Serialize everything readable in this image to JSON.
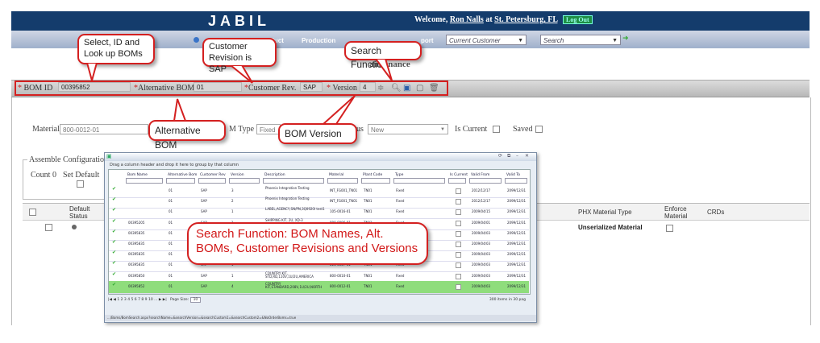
{
  "header": {
    "logo": "JABIL",
    "welcome_prefix": "Welcome,",
    "user": "Ron Nalls",
    "at": "at",
    "location": "St. Petersburg, FL",
    "logout": "Log Out"
  },
  "nav": {
    "items": [
      "duct",
      "Production",
      "port"
    ],
    "customer_select": "Current Customer",
    "search_select": "Search"
  },
  "page_title": "aintenance",
  "bom_bar": {
    "bom_id_label": "BOM ID",
    "bom_id_value": "00395852",
    "alt_bom_label": "Alternative BOM",
    "alt_bom_value": "01",
    "cust_rev_label": "Customer Rev.",
    "cust_rev_value": "SAP",
    "version_label": "Version",
    "version_value": "4"
  },
  "form": {
    "material_label": "Material",
    "material_value": "800-0012-01",
    "bom_type_label": "M Type",
    "bom_type_value": "Fixed",
    "status_label": "us",
    "status_value": "New",
    "is_current_label": "Is Current",
    "saved_label": "Saved",
    "assemble_config_label": "Assemble Configuratio",
    "count_label": "Count 0",
    "set_default_label": "Set Default"
  },
  "grid_header": {
    "default_status": "Default Status",
    "phx_material_type": "PHX Material Type",
    "enforce_material": "Enforce Material",
    "crds": "CRDs"
  },
  "grid_row": {
    "phx_value": "Unserialized Material"
  },
  "popup": {
    "group_hint": "Drag a column header and drop it here to group by that column",
    "columns": [
      "Bom Name",
      "Alternative Bom",
      "Customer Rev",
      "Version",
      "Description",
      "Material",
      "Plant Code",
      "Type",
      "Is Current",
      "Valid From",
      "Valid To"
    ],
    "rows": [
      {
        "bom": "",
        "alt": "01",
        "rev": "SAP",
        "ver": "3",
        "desc": "Phoenix Integration Testing",
        "mat": "INT_FG001_TN01",
        "plant": "TN01",
        "type": "Fixed",
        "from": "2012/12/17",
        "to": "2099/12/31"
      },
      {
        "bom": "",
        "alt": "01",
        "rev": "SAP",
        "ver": "2",
        "desc": "Phoenix Integration Testing",
        "mat": "INT_FG001_TN01",
        "plant": "TN01",
        "type": "Fixed",
        "from": "2012/12/17",
        "to": "2099/12/31"
      },
      {
        "bom": "",
        "alt": "01",
        "rev": "SAP",
        "ver": "1",
        "desc": "LABEL,AGENCY,SN/PN,3Q0920I test1",
        "mat": "105-0016-01",
        "plant": "TN01",
        "type": "Fixed",
        "from": "2009/04/15",
        "to": "2099/12/31"
      },
      {
        "bom": "00395205",
        "alt": "01",
        "rev": "SAP",
        "ver": "1",
        "desc": "SHIPPING KIT, 2U, XD-3",
        "mat": "800-0006-01",
        "plant": "TN01",
        "type": "Fixed",
        "from": "2009/04/01",
        "to": "2099/12/31"
      },
      {
        "bom": "00395835",
        "alt": "01",
        "rev": "",
        "ver": "",
        "desc": "",
        "mat": "",
        "plant": "",
        "type": "",
        "from": "2009/04/03",
        "to": "2099/12/31"
      },
      {
        "bom": "00395835",
        "alt": "01",
        "rev": "",
        "ver": "",
        "desc": "",
        "mat": "",
        "plant": "",
        "type": "",
        "from": "2009/04/03",
        "to": "2099/12/31"
      },
      {
        "bom": "00395835",
        "alt": "01",
        "rev": "",
        "ver": "",
        "desc": "",
        "mat": "",
        "plant": "",
        "type": "",
        "from": "2009/04/03",
        "to": "2099/12/31"
      },
      {
        "bom": "00395835",
        "alt": "01",
        "rev": "SAP",
        "ver": "1",
        "desc": "SPARES KIT, 250GB HD, SATA ROHS",
        "mat": "811-0057-01",
        "plant": "TN01",
        "type": "Fixed",
        "from": "2009/04/03",
        "to": "2099/12/31"
      },
      {
        "bom": "00395850",
        "alt": "01",
        "rev": "SAP",
        "ver": "1",
        "desc": "COUNTRY KIT, STD,RD,110V,1U/2U,AMERICA",
        "mat": "800-0010-01",
        "plant": "TN01",
        "type": "Fixed",
        "from": "2009/04/03",
        "to": "2099/12/31"
      },
      {
        "bom": "00395852",
        "alt": "01",
        "rev": "SAP",
        "ver": "4",
        "desc": "COUNTRY KIT,STANDARD,208V,1U/2U,NORTH",
        "mat": "800-0012-01",
        "plant": "TN01",
        "type": "Fixed",
        "from": "2009/04/03",
        "to": "2099/12/31"
      }
    ],
    "pager": "1 2 3 4 5 6 7 8 9 10 ...",
    "page_size_label": "Page Size:",
    "page_size_value": "10",
    "items_info": "300 items in 30 pag",
    "status_url": ".../Boms/BomSearch.aspx?searchName=&searchVersion=&searchCustom1=&searchCustom2=&NoOrderBoms=true"
  },
  "callouts": {
    "select_id": "Select, ID and Look up BOMs",
    "customer_rev": "Customer Revision is SAP",
    "search_function": "Search Function",
    "alternative_bom": "Alternative BOM",
    "bom_version": "BOM Version",
    "search_big": "Search Function: BOM Names, Alt. BOMs, Customer Revisions and Versions"
  },
  "colors": {
    "header_bg": "#143c6c",
    "callout_border": "#d42020",
    "selected_row": "#8fdd7c"
  }
}
